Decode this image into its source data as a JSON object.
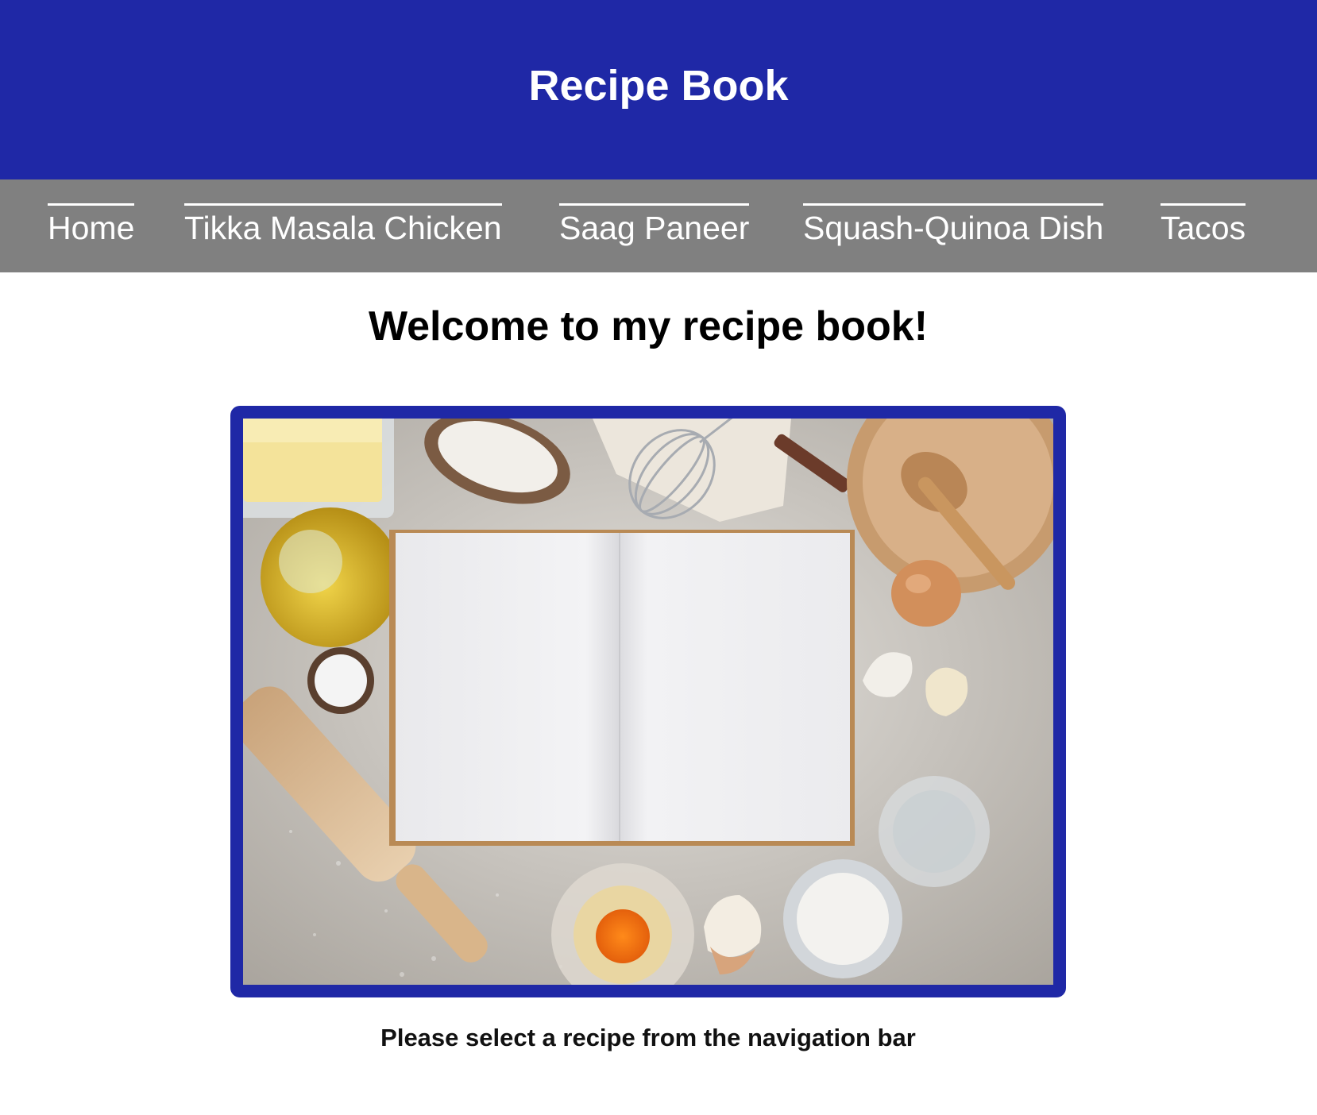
{
  "header": {
    "title": "Recipe Book"
  },
  "nav": {
    "items": [
      {
        "label": "Home"
      },
      {
        "label": "Tikka Masala Chicken"
      },
      {
        "label": "Saag Paneer"
      },
      {
        "label": "Squash-Quinoa Dish"
      },
      {
        "label": "Tacos"
      }
    ]
  },
  "main": {
    "heading": "Welcome to my recipe book!",
    "prompt": "Please select a recipe from the navigation bar"
  },
  "colors": {
    "header_bg": "#1f28a6",
    "nav_bg": "#808080",
    "frame_border": "#1f28a6"
  }
}
